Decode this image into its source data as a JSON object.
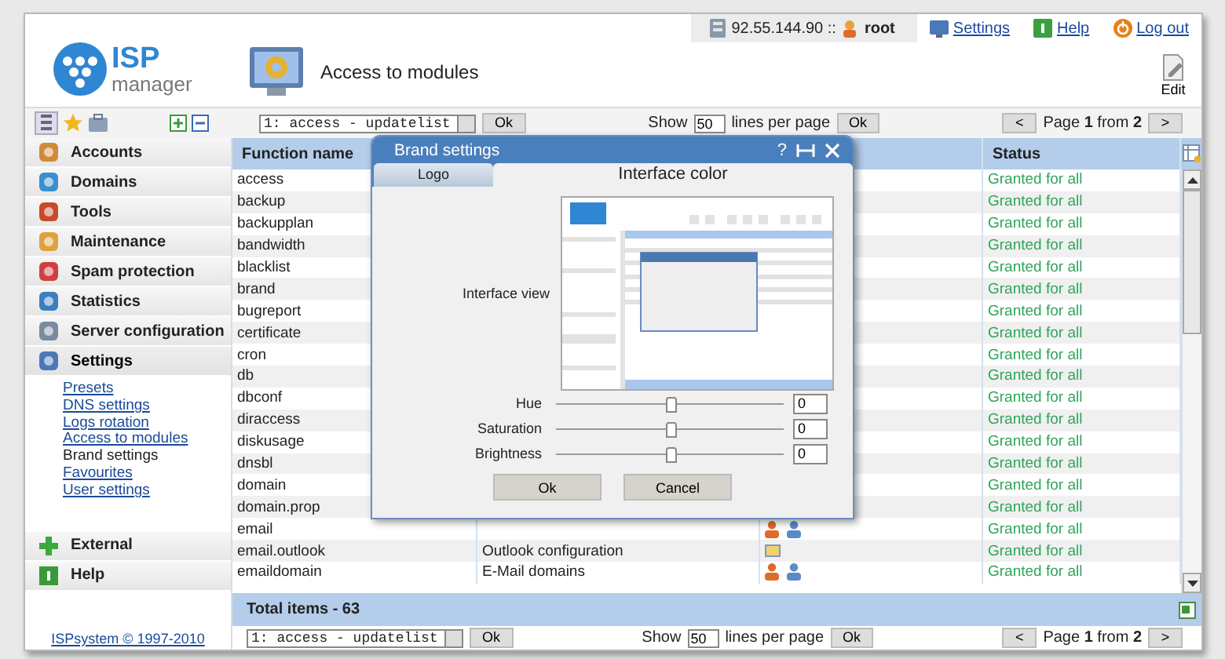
{
  "header": {
    "logo_top": "ISP",
    "logo_bottom": "manager",
    "title": "Access to modules",
    "server": "92.55.144.90 ::",
    "user": "root",
    "links": [
      "Settings",
      "Help",
      "Log out"
    ],
    "edit": "Edit"
  },
  "toolbar": {
    "filter": "1: access - updatelist",
    "ok": "Ok",
    "show": "Show",
    "lines": "50",
    "per_page": "lines per page",
    "ok_lines": "Ok",
    "prev": "<",
    "page": "Page **1** from **2**",
    "next": ">"
  },
  "sidebar": {
    "items": [
      {
        "label": "Accounts",
        "expanded": false
      },
      {
        "label": "Domains",
        "expanded": false
      },
      {
        "label": "Tools",
        "expanded": false
      },
      {
        "label": "Maintenance",
        "expanded": false
      },
      {
        "label": "Spam protection",
        "expanded": false
      },
      {
        "label": "Statistics",
        "expanded": false
      },
      {
        "label": "Server configuration",
        "expanded": false
      },
      {
        "label": "Settings",
        "expanded": true,
        "children": [
          {
            "label": "Presets",
            "selected": false
          },
          {
            "label": "DNS settings",
            "selected": false
          },
          {
            "label": "Logs rotation",
            "selected": false
          },
          {
            "label": "Access to modules",
            "selected": false
          },
          {
            "label": "Brand settings",
            "selected": true
          },
          {
            "label": "Favourites",
            "selected": false
          },
          {
            "label": "User settings",
            "selected": false
          }
        ]
      }
    ],
    "bottom_items": [
      {
        "label": "External",
        "expanded": false
      },
      {
        "label": "Help",
        "expanded": false
      }
    ],
    "copyright": "ISPsystem © 1997-2010"
  },
  "table": {
    "function_header": "Function name",
    "status_header": "Status",
    "rows": [
      {
        "function": "access",
        "status": "Granted for all"
      },
      {
        "function": "backup",
        "status": "Granted for all"
      },
      {
        "function": "backupplan",
        "status": "Granted for all"
      },
      {
        "function": "bandwidth",
        "status": "Granted for all"
      },
      {
        "function": "blacklist",
        "status": "Granted for all"
      },
      {
        "function": "brand",
        "status": "Granted for all"
      },
      {
        "function": "bugreport",
        "status": "Granted for all"
      },
      {
        "function": "certificate",
        "status": "Granted for all"
      },
      {
        "function": "cron",
        "status": "Granted for all"
      },
      {
        "function": "db",
        "status": "Granted for all"
      },
      {
        "function": "dbconf",
        "status": "Granted for all"
      },
      {
        "function": "diraccess",
        "status": "Granted for all"
      },
      {
        "function": "diskusage",
        "status": "Granted for all"
      },
      {
        "function": "dnsbl",
        "status": "Granted for all"
      },
      {
        "function": "domain",
        "status": "Granted for all"
      },
      {
        "function": "domain.prop",
        "status": "Granted for all"
      },
      {
        "function": "email",
        "status": "Granted for all",
        "icons": [
          {
            "kind": "admin"
          },
          {
            "kind": "user"
          }
        ]
      },
      {
        "function": "email.outlook",
        "description": "Outlook configuration",
        "status": "Granted for all",
        "icons": [
          {
            "kind": "config"
          }
        ]
      },
      {
        "function": "emaildomain",
        "description": "E-Mail domains",
        "status": "Granted for all",
        "icons": [
          {
            "kind": "admin"
          },
          {
            "kind": "user"
          }
        ]
      }
    ],
    "total": "Total items - 63"
  },
  "bottom_toolbar": {
    "filter": "1: access - updatelist",
    "ok": "Ok",
    "show": "Show",
    "lines": "50",
    "per_page": "lines per page",
    "ok_lines": "Ok",
    "prev": "<",
    "page": "Page **1** from **2**",
    "next": ">"
  },
  "dialog": {
    "title": "Brand settings",
    "help": "?",
    "tabs": [
      {
        "label": "Logo",
        "selected": false
      },
      {
        "label": "Interface color",
        "selected": true
      }
    ],
    "preview_label": "Interface view",
    "sliders": [
      {
        "label": "Hue",
        "level": 0.5,
        "value": "0"
      },
      {
        "label": "Saturation",
        "level": 0.5,
        "value": "0"
      },
      {
        "label": "Brightness",
        "level": 0.5,
        "value": "0"
      }
    ],
    "buttons": [
      "Ok",
      "Cancel"
    ]
  }
}
